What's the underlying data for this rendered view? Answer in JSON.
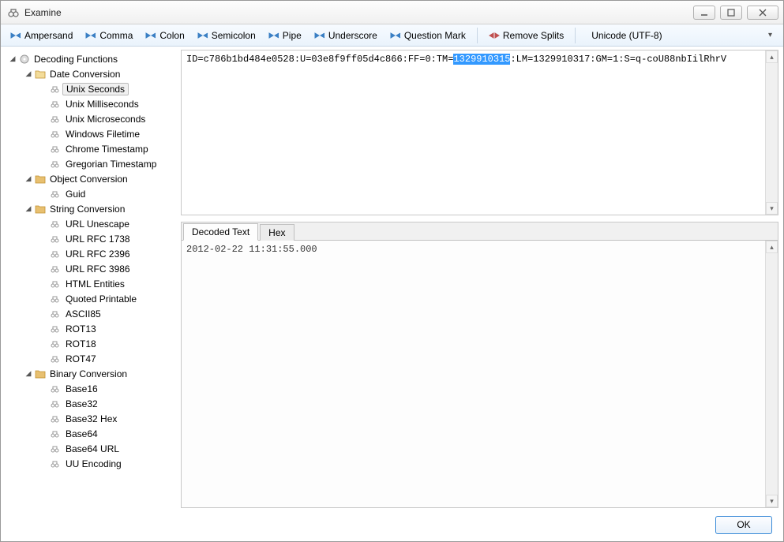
{
  "window": {
    "title": "Examine"
  },
  "toolbar": {
    "buttons": {
      "ampersand": "Ampersand",
      "comma": "Comma",
      "colon": "Colon",
      "semicolon": "Semicolon",
      "pipe": "Pipe",
      "underscore": "Underscore",
      "question": "Question Mark",
      "remove": "Remove Splits"
    },
    "encoding_value": "Unicode (UTF-8)"
  },
  "tree": {
    "root": "Decoding Functions",
    "groups": [
      {
        "label": "Date Conversion",
        "items": [
          "Unix Seconds",
          "Unix Milliseconds",
          "Unix Microseconds",
          "Windows Filetime",
          "Chrome Timestamp",
          "Gregorian Timestamp"
        ],
        "selected": "Unix Seconds"
      },
      {
        "label": "Object Conversion",
        "items": [
          "Guid"
        ]
      },
      {
        "label": "String Conversion",
        "items": [
          "URL Unescape",
          "URL RFC 1738",
          "URL RFC 2396",
          "URL RFC 3986",
          "HTML Entities",
          "Quoted Printable",
          "ASCII85",
          "ROT13",
          "ROT18",
          "ROT47"
        ]
      },
      {
        "label": "Binary Conversion",
        "items": [
          "Base16",
          "Base32",
          "Base32 Hex",
          "Base64",
          "Base64 URL",
          "UU Encoding"
        ]
      }
    ]
  },
  "input": {
    "pre": "ID=c786b1bd484e0528:U=03e8f9ff05d4c866:FF=0:TM=",
    "selected": "1329910315",
    "post": ":LM=1329910317:GM=1:S=q-coU88nbIilRhrV"
  },
  "tabs": {
    "decoded": "Decoded Text",
    "hex": "Hex"
  },
  "output": {
    "decoded_text": "2012-02-22 11:31:55.000"
  },
  "footer": {
    "ok": "OK"
  }
}
